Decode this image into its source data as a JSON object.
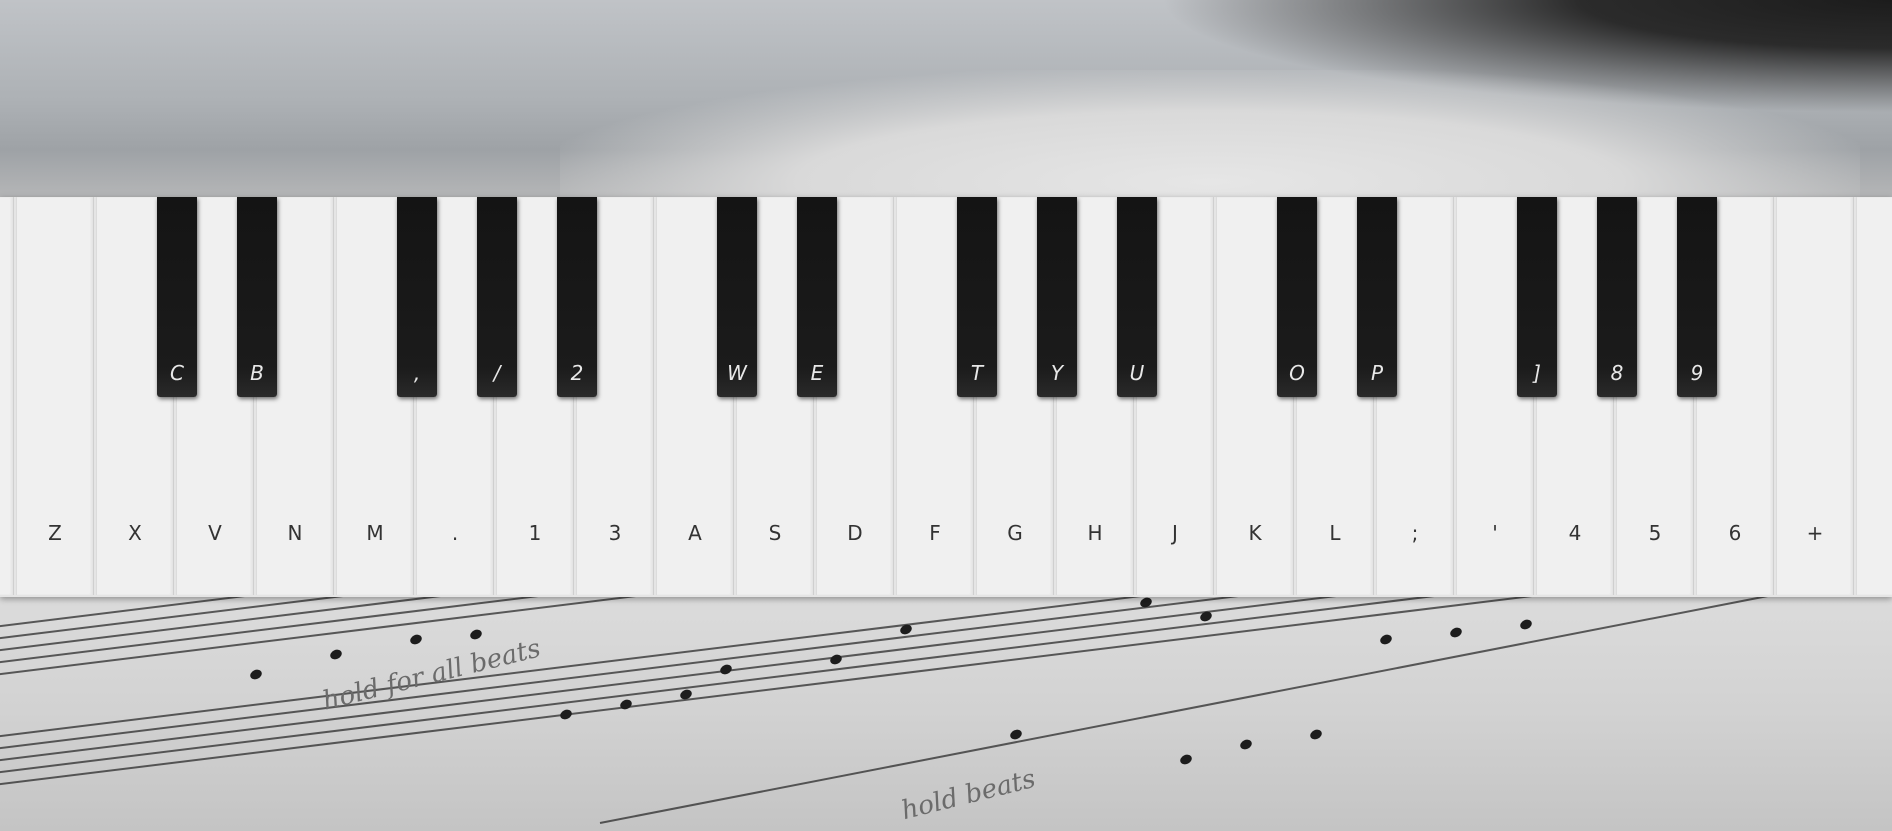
{
  "keyboard": {
    "white_keys": [
      "",
      "Z",
      "X",
      "V",
      "N",
      "M",
      ".",
      "1",
      "3",
      "A",
      "S",
      "D",
      "F",
      "G",
      "H",
      "J",
      "K",
      "L",
      ";",
      "'",
      "4",
      "5",
      "6",
      "+",
      ""
    ],
    "black_keys": [
      "C",
      "B",
      ",",
      "/",
      "2",
      "W",
      "E",
      "T",
      "Y",
      "U",
      "O",
      "P",
      "]",
      "8",
      "9"
    ]
  },
  "colors": {
    "white_key": "#f0f0f0",
    "black_key": "#141414",
    "white_label": "#333333",
    "black_label": "#e8e8e8"
  }
}
